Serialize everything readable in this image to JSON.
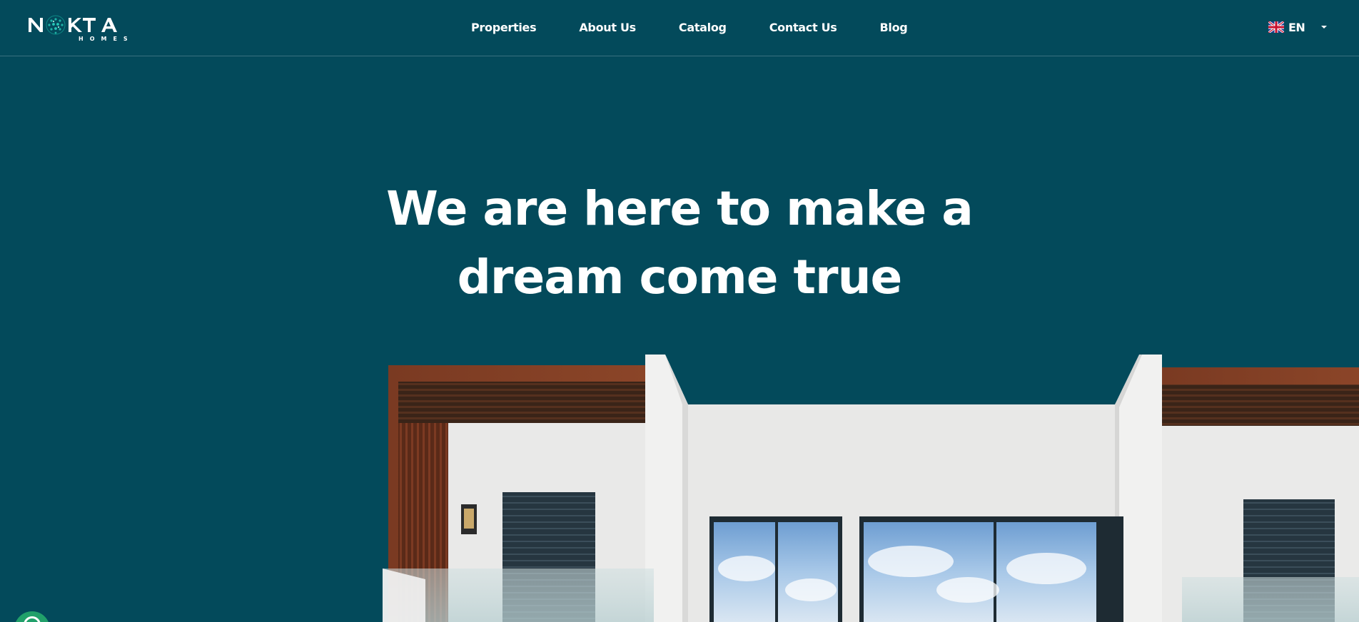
{
  "brand": {
    "logo_text": "NOKTA",
    "logo_subtext": "HOMES",
    "primary_color": "#034a5b",
    "accent_color": "#1fb2a6"
  },
  "nav": {
    "items": [
      {
        "label": "Properties"
      },
      {
        "label": "About Us"
      },
      {
        "label": "Catalog"
      },
      {
        "label": "Contact Us"
      },
      {
        "label": "Blog"
      }
    ]
  },
  "language": {
    "code": "EN",
    "flag_icon": "uk-flag-icon",
    "caret_icon": "caret-down-icon"
  },
  "hero": {
    "title_line1": "We are here to make a",
    "title_line2": "dream come true",
    "image_subject": "modern-white-villa-photo"
  },
  "chat": {
    "icon": "chat-bubble-icon",
    "color": "#21a06a"
  }
}
